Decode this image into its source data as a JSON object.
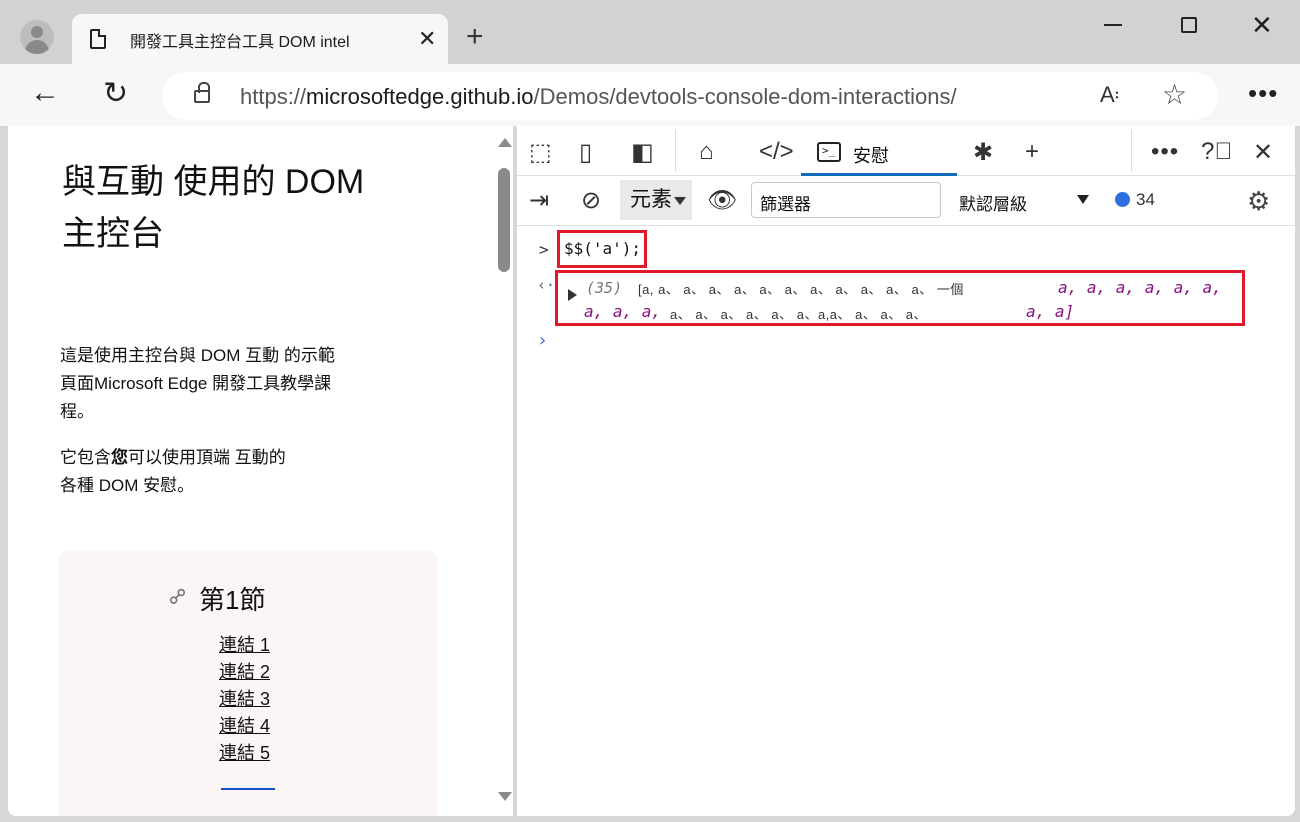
{
  "browser": {
    "tab_title": "開發工具主控台工具 DOM intel",
    "url_prefix": "https://",
    "url_host": "microsoftedge.github.io",
    "url_path": "/Demos/devtools-console-dom-interactions/"
  },
  "page": {
    "heading": "與互動 使用的 DOM 主控台",
    "intro1": "這是使用主控台與 DOM 互動 的示範頁面Microsoft Edge 開發工具教學課程。",
    "intro2_a": "它包含",
    "intro2_bold": "您",
    "intro2_b": "可以使用頂端 互動的各種 DOM 安慰。",
    "section_title": "第1節",
    "links": [
      "連結 1",
      "連結 2",
      "連結 3",
      "連結 4",
      "連結 5"
    ]
  },
  "devtools": {
    "console_tab": "安慰",
    "context": "元素",
    "filter_placeholder": "篩選器",
    "levels": "默認層級",
    "message_count": "34",
    "command": "$$('a');",
    "result_count": "(35)",
    "result_line1_plain": "[a,  a、 a、 a、 a、 a、  a、 a、  a、 a、 a、 a、 一個",
    "result_line1_italic": "a, a, a, a, a, a,",
    "result_line2_italic_a": "a, a, a,",
    "result_line2_plain": "a、 a、  a、 a、 a、  a、a,a、  a、 a、   a、",
    "result_line2_italic_b": "a, a]"
  },
  "colors": {
    "highlight_box": "#e0192a",
    "accent": "#0f6cbd",
    "element_purple": "#881280"
  }
}
